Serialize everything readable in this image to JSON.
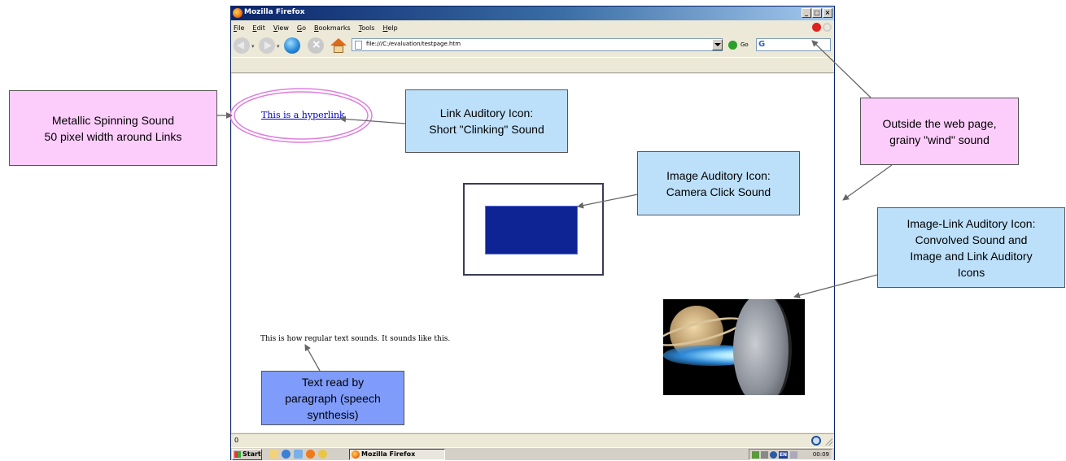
{
  "browser": {
    "window_title": "Mozilla Firefox",
    "window_buttons": [
      "_",
      "□",
      "×"
    ],
    "menu": [
      "File",
      "Edit",
      "View",
      "Go",
      "Bookmarks",
      "Tools",
      "Help"
    ],
    "url": "file:///C:/evaluation/testpage.htm",
    "go_label": "Go",
    "search_icon": "G"
  },
  "page": {
    "link_text": "This is a hyperlink",
    "paragraph_text": "This is how regular text sounds. It sounds like this."
  },
  "status": {
    "text": "0"
  },
  "taskbar": {
    "start_label": "Start",
    "task_button": "Mozilla Firefox",
    "clock": "00:09",
    "tray_lang": "EN"
  },
  "callouts": {
    "metallic": "Metallic Spinning Sound\n50 pixel width around Links",
    "link_icon": "Link Auditory Icon:\nShort \"Clinking\" Sound",
    "image_icon": "Image Auditory Icon:\nCamera Click Sound",
    "outside": "Outside the web page,\ngrainy \"wind\" sound",
    "image_link": "Image-Link Auditory Icon:\nConvolved Sound and\nImage and Link Auditory\nIcons",
    "text_read": "Text read by\nparagraph (speech\nsynthesis)"
  },
  "colors": {
    "pink_callout": "#fccdfb",
    "light_blue_callout": "#bde0fa",
    "medium_blue_callout": "#7f9cfb",
    "link_ellipse": "#e07ee0",
    "image_blue": "#0f2494"
  }
}
